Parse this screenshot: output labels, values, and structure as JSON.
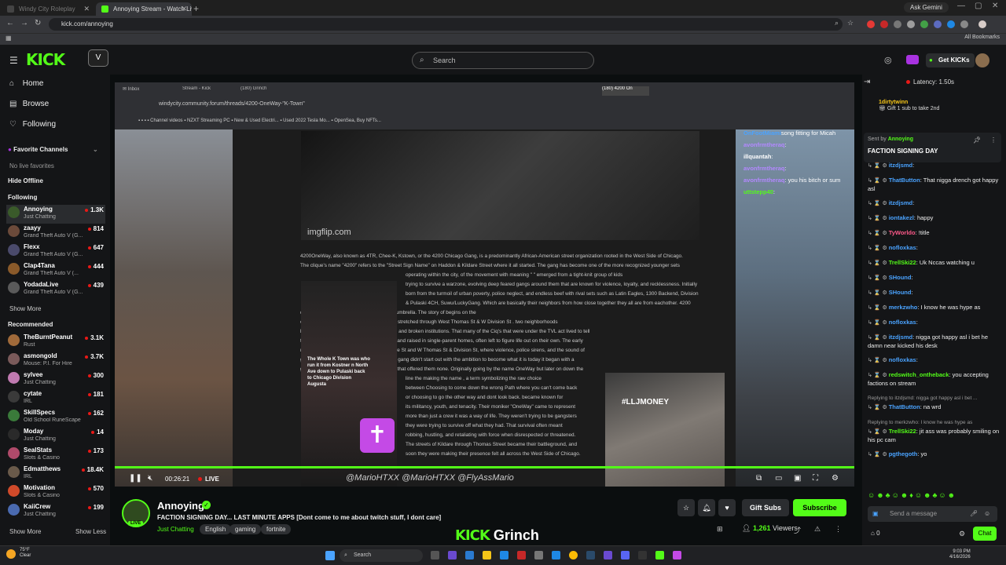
{
  "browser": {
    "tabs": [
      {
        "label": "Windy City Roleplay",
        "active": false
      },
      {
        "label": "Annoying Stream - Watch Live - ",
        "active": true
      }
    ],
    "url": "kick.com/annoying",
    "ask_gemini": "Ask Gemini",
    "all_bookmarks": "All Bookmarks"
  },
  "header": {
    "logo": "KICK",
    "search_placeholder": "Search",
    "get_kicks": "Get KICKs"
  },
  "sidebar": {
    "nav": [
      {
        "label": "Home",
        "icon": "home-icon"
      },
      {
        "label": "Browse",
        "icon": "browse-icon"
      },
      {
        "label": "Following",
        "icon": "heart-icon"
      }
    ],
    "favorite_channels": "Favorite Channels",
    "no_favorites": "No live favorites",
    "hide_offline": "Hide Offline",
    "following_title": "Following",
    "following": [
      {
        "name": "Annoying",
        "game": "Just Chatting",
        "viewers": "1.3K",
        "color": "#3a5a2a"
      },
      {
        "name": "zaayy",
        "game": "Grand Theft Auto V (G...",
        "viewers": "814",
        "color": "#6b4a3a"
      },
      {
        "name": "Flexx",
        "game": "Grand Theft Auto V (G...",
        "viewers": "647",
        "color": "#4a4a6b"
      },
      {
        "name": "Clap4Tana",
        "game": "Grand Theft Auto V (...",
        "viewers": "444",
        "color": "#8a5a2a"
      },
      {
        "name": "YodadaLive",
        "game": "Grand Theft Auto V (G...",
        "viewers": "439",
        "color": "#5a5a5a"
      }
    ],
    "show_more": "Show More",
    "recommended_title": "Recommended",
    "recommended": [
      {
        "name": "TheBurntPeanut",
        "game": "Rust",
        "viewers": "3.1K",
        "color": "#a06a3a"
      },
      {
        "name": "asmongold",
        "game": "Mouse: P.I. For Hire",
        "viewers": "3.7K",
        "color": "#7a5a5a"
      },
      {
        "name": "sylvee",
        "game": "Just Chatting",
        "viewers": "300",
        "color": "#c07ab0"
      },
      {
        "name": "cytate",
        "game": "IRL",
        "viewers": "181",
        "color": "#3a3a3a"
      },
      {
        "name": "SkillSpecs",
        "game": "Old School RuneScape",
        "viewers": "162",
        "color": "#3a7a3a"
      },
      {
        "name": "Moday",
        "game": "Just Chatting",
        "viewers": "14",
        "color": "#2a2a2a"
      },
      {
        "name": "SealStats",
        "game": "Slots & Casino",
        "viewers": "173",
        "color": "#b04a6a"
      },
      {
        "name": "Edmatthews",
        "game": "IRL",
        "viewers": "18.4K",
        "color": "#6a5a4a"
      },
      {
        "name": "Motivation",
        "game": "Slots & Casino",
        "viewers": "570",
        "color": "#d04a2a"
      },
      {
        "name": "KaiiCrew",
        "game": "Just Chatting",
        "viewers": "199",
        "color": "#4a6ab0"
      }
    ],
    "show_more_2": "Show More",
    "show_less": "Show Less"
  },
  "video": {
    "inner_url": "windycity.community.forum/threads/4200-OneWay-\"K-Town\"",
    "imgflip": "imgflip.com",
    "article_lines": [
      "4200OneWay, also known as 4TR, Chee-K, Kstown, or the 4200 Chicago Gang, is a predominantly African-American street organization rooted in the West Side of Chicago.",
      "The clique's name \"4200\" refers to the \"Street Sign Name\" on Haddon & Kildare Street where it all started. The gang has become one of the more recognized younger sets",
      "operating within the city, of the movement with meaning \" \" emerged from a tight-knit group of kids",
      "trying to survive a warzone, evolving deep feared gangs around them that are known for violence, loyalty, and recklessness. Initially",
      "born from the turmoil of urban poverty, police neglect, and endless beef with rival sets such as Latin Eagles, 1300 Backend, Division",
      "& Pulaski 4CH, Suwu/LuckyGang. Which are basically their neighbors from how close together they all are from eachother. 4200",
      "quickly grew into a solidified unit under the umbrella. The story of begins on the",
      "on a street that is named Haddon & Kildare stretched through West Thomas St & W Division St . two neighborhoods",
      "long plagued by gun violence, drug dealing, and broken institutions. That many of the Ciq's that were under the TVL act lived to tell",
      "the story. That teenagers, born into poverty and raised in single-parent homes, often left to figure life out on their own. The early",
      "members hung out around Haddon & Kildare St and W Thomas St & Division St, where violence, police sirens, and the sound of",
      "gunfire became as familiar as laughter. The gang didn't start out with the ambition to become what it is today it began with a",
      "group of kids trying to earn respect in a city that offered them none. Originally going by the name OneWay but later on down the",
      "line the making the name , a term symbolizing the raw choice",
      "between Choosing to come down the wrong Path where you can't come back",
      "or choosing to go the other way and dont look back. became known for",
      "its militancy, youth, and tenacity. Their moniker \"OneWay\" came to represent",
      "more than just a crew it was a way of life. They weren't trying to be gangsters",
      "they were trying to survive off what they had. That survival often meant",
      "robbing, hustling, and retaliating with force when disrespected or threatened.",
      "The streets of Kildare through Thomas Street became their battleground, and",
      "soon they were making their presence felt all across the West Side of Chicago."
    ],
    "insta_caption": "The Whole K Town was who run it from Kostner n North Ave down to Pulaski back to Chicago Division Augusta",
    "llj": "#LLJMONEY",
    "overlay_chat": [
      {
        "user": "OnFootMiami",
        "msg": "song fitting for Micah",
        "color": "#4aa3ff"
      },
      {
        "user": "avonfrmtheraq",
        "msg": ":",
        "color": "#b388ff"
      },
      {
        "user": "illquantah",
        "msg": ":",
        "color": "#ffffff"
      },
      {
        "user": "avonfrmtheraq",
        "msg": ":",
        "color": "#b388ff"
      },
      {
        "user": "avonfrmtheraq",
        "msg": ": you his bitch or sum",
        "color": "#b388ff"
      },
      {
        "user": "uttstepp40",
        "msg": ":",
        "color": "#53fc18"
      }
    ],
    "timecode": "00:26:21",
    "live_label": "LIVE",
    "handles": "@MarioHTXX @MarioHTXX @FlyAssMario",
    "progress": 1.0
  },
  "channel": {
    "name": "Annoying",
    "title": "FACTION SIGNING DAY... LAST MINUTE APPS [Dont come to me about twitch stuff, I dont care]",
    "category": "Just Chatting",
    "tags": [
      "English",
      "gaming",
      "fortnite"
    ],
    "gift_subs": "Gift Subs",
    "subscribe": "Subscribe",
    "viewers": "1,261",
    "viewers_label": "Viewers",
    "live_badge": "LIVE",
    "banner_kick": "KICK",
    "banner_text": "Grinch"
  },
  "chat": {
    "latency": "Latency: 1.50s",
    "gift_user": "1dirtytwinn",
    "gift_text": "Gift 1 sub to take 2nd",
    "pinned_by": "Annoying",
    "pinned_sent": "Sent by",
    "pinned_msg": "FACTION SIGNING DAY",
    "messages": [
      {
        "user": "itzdjsmd",
        "msg": ":",
        "color": "#4aa3ff"
      },
      {
        "user": "ThatButton",
        "msg": ": That nigga drench got happy asl",
        "color": "#4aa3ff"
      },
      {
        "user": "itzdjsmd",
        "msg": ":",
        "color": "#4aa3ff"
      },
      {
        "user": "iontakezl",
        "msg": ": happy",
        "color": "#4aa3ff"
      },
      {
        "user": "TyWorldo",
        "msg": ": !title",
        "color": "#ff5a8a"
      },
      {
        "user": "nofloxkas",
        "msg": ":",
        "color": "#4aa3ff"
      },
      {
        "user": "TrellSki22",
        "msg": ": Uk Nccas watching u",
        "color": "#53fc18"
      },
      {
        "user": "SHound",
        "msg": ":",
        "color": "#4aa3ff"
      },
      {
        "user": "SHound",
        "msg": ":",
        "color": "#4aa3ff"
      },
      {
        "user": "merkzwho",
        "msg": ": I know he was hype as",
        "color": "#4aa3ff"
      },
      {
        "user": "nofloxkas",
        "msg": ":",
        "color": "#4aa3ff"
      },
      {
        "user": "itzdjsmd",
        "msg": ": nigga got happy asl i bet he damn near kicked his desk",
        "color": "#4aa3ff"
      },
      {
        "user": "nofloxkas",
        "msg": ":",
        "color": "#4aa3ff"
      },
      {
        "user": "redswitch_ontheback",
        "msg": ": you accepting factions on stream",
        "color": "#53fc18"
      },
      {
        "user": "ThatButton",
        "msg": ": na wrd",
        "color": "#4aa3ff",
        "reply": "Replying to itzdjsmd: nigga got happy asl i bet ..."
      },
      {
        "user": "TrellSki22",
        "msg": ": jit ass was probably smiling on his pc cam",
        "color": "#53fc18",
        "reply": "Replying to merkzwho: I know he was hype as"
      },
      {
        "user": "pgthegoth",
        "msg": ": yo",
        "color": "#4aa3ff"
      }
    ],
    "input_placeholder": "Send a message",
    "chat_button": "Chat",
    "points": "0"
  },
  "taskbar": {
    "weather_temp": "75°F",
    "weather_desc": "Clear",
    "search": "Search",
    "time": "9:03 PM",
    "date": "4/16/2026"
  },
  "colors": {
    "kick_green": "#53fc18",
    "bg": "#0b0e0f",
    "panel": "#141517"
  }
}
